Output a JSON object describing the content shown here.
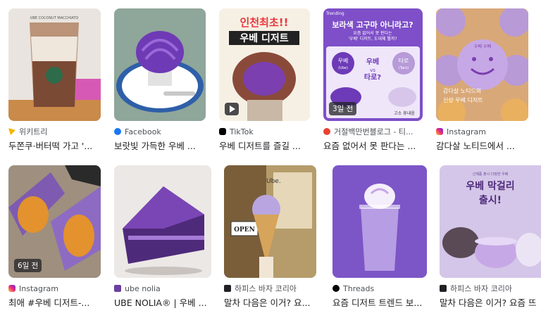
{
  "row1": [
    {
      "source": "위키트리",
      "title": "두쫀쿠·버터떡 가고 '...",
      "icon": "wikitree-icon"
    },
    {
      "source": "Facebook",
      "title": "보랏빛 가득한 우베 ...",
      "icon": "facebook-icon"
    },
    {
      "source": "TikTok",
      "title": "우베 디저트를 즐길 ...",
      "icon": "tiktok-icon"
    },
    {
      "source": "거절백만번블로그 - 티...",
      "title": "요즘 없어서 못 판다는 ...",
      "icon": "blog-icon",
      "badge": "3일 전"
    },
    {
      "source": "Instagram",
      "title": "감다살 노티드에서 ...",
      "icon": "instagram-icon"
    }
  ],
  "row2": [
    {
      "source": "Instagram",
      "title": "최애 #우베 디저트-...",
      "icon": "instagram-icon",
      "badge": "6일 전"
    },
    {
      "source": "ube nolia",
      "title": "UBE NOLIA® | 우베 ...",
      "icon": "ube-nolia-icon"
    },
    {
      "source": "하피스 바자 코리아",
      "title": "말차 다음은 이거? 요...",
      "icon": "harpers-bazaar-icon"
    },
    {
      "source": "Threads",
      "title": "요즘 디저트 트렌드 보...",
      "icon": "threads-icon"
    },
    {
      "source": "하피스 바자 코리아",
      "title": "말차 다음은 이거? 요즘 뜨",
      "icon": "harpers-bazaar-icon"
    }
  ],
  "image_text": {
    "starbucks_cup": "UBE COCONUT MACCHIATO",
    "tiktok_line1": "인천최초!!",
    "tiktok_line2": "우베 디저트",
    "blog_banner": "Trending",
    "blog_headline": "보라색 고구마 아니라고?",
    "blog_sub1": "요즘 없어서 못 판다는",
    "blog_sub2": "'우베' 디저트, 도대체 뭘까?",
    "blog_ube": "우베",
    "blog_ube_en": "(Ube)",
    "blog_taro": "타로",
    "blog_taro_en": "(Taro)",
    "blog_vs1": "우베",
    "blog_vs2": "vs",
    "blog_vs3": "타로?",
    "blog_footer": "고소 휴내음",
    "knotted_sign": "우베 우베",
    "knotted_text1": "감다살 노티드의",
    "knotted_text2": "신상 우베 디저트",
    "bazaar_store": "Ube.",
    "bazaar_sign": "OPEN",
    "makgeolli_top": "신제품 출시 다정한 우베",
    "makgeolli_title1": "우베 막걸리",
    "makgeolli_title2": "출시!"
  }
}
